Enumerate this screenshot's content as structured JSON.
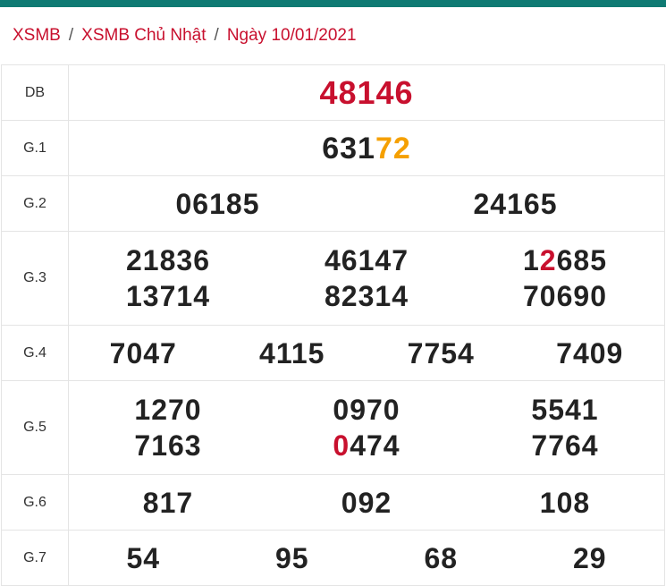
{
  "breadcrumb": {
    "home": "XSMB",
    "sep1": "/",
    "day": "XSMB Chủ Nhật",
    "sep2": "/",
    "date": "Ngày 10/01/2021"
  },
  "prizes": {
    "db": {
      "label": "DB",
      "numbers": [
        "48146"
      ]
    },
    "g1": {
      "label": "G.1",
      "numbers": [
        {
          "plain": "631",
          "highlight": "72"
        }
      ]
    },
    "g2": {
      "label": "G.2",
      "numbers": [
        "06185",
        "24165"
      ]
    },
    "g3": {
      "label": "G.3",
      "rows": [
        [
          {
            "pre": "21836",
            "hl": "",
            "post": ""
          },
          {
            "pre": "46147",
            "hl": "",
            "post": ""
          },
          {
            "pre": "1",
            "hl": "2",
            "post": "685"
          }
        ],
        [
          {
            "pre": "13714",
            "hl": "",
            "post": ""
          },
          {
            "pre": "82314",
            "hl": "",
            "post": ""
          },
          {
            "pre": "70690",
            "hl": "",
            "post": ""
          }
        ]
      ]
    },
    "g4": {
      "label": "G.4",
      "numbers": [
        "7047",
        "4115",
        "7754",
        "7409"
      ]
    },
    "g5": {
      "label": "G.5",
      "rows": [
        [
          {
            "pre": "1270",
            "hl": "",
            "post": ""
          },
          {
            "pre": "0970",
            "hl": "",
            "post": ""
          },
          {
            "pre": "5541",
            "hl": "",
            "post": ""
          }
        ],
        [
          {
            "pre": "7163",
            "hl": "",
            "post": ""
          },
          {
            "pre": "",
            "hl": "0",
            "post": "474"
          },
          {
            "pre": "7764",
            "hl": "",
            "post": ""
          }
        ]
      ]
    },
    "g6": {
      "label": "G.6",
      "numbers": [
        "817",
        "092",
        "108"
      ]
    },
    "g7": {
      "label": "G.7",
      "numbers": [
        "54",
        "95",
        "68",
        "29"
      ]
    }
  },
  "colors": {
    "accent_bar": "#0f7a73",
    "red": "#c8102e",
    "orange": "#f5a000"
  }
}
